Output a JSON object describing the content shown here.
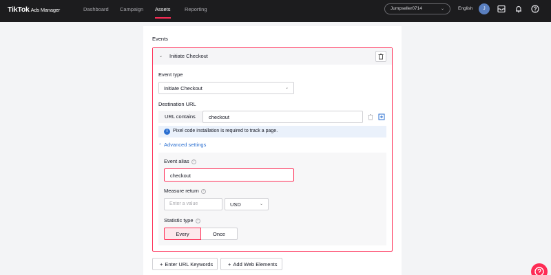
{
  "header": {
    "logo": "TikTok",
    "logo_sub": "Ads Manager",
    "nav": [
      "Dashboard",
      "Campaign",
      "Assets",
      "Reporting"
    ],
    "active_nav": "Assets",
    "account": "Jumpseller0714",
    "language": "English",
    "avatar_initial": "J"
  },
  "main": {
    "section_title": "Events",
    "event": {
      "header_title": "Initiate Checkout",
      "event_type_label": "Event type",
      "event_type_value": "Initiate Checkout",
      "destination_url_label": "Destination URL",
      "url_rule_label": "URL contains",
      "url_rule_value": "checkout",
      "info_text": "Pixel code installation is required to track a page.",
      "advanced_settings": "Advanced settings",
      "event_alias_label": "Event alias",
      "event_alias_value": "checkout",
      "measure_return_label": "Measure return",
      "measure_return_placeholder": "Enter a value",
      "currency": "USD",
      "statistic_type_label": "Statistic type",
      "statistic_options": [
        "Every",
        "Once"
      ],
      "statistic_selected": "Every"
    },
    "buttons": {
      "enter_url_keywords": "Enter URL Keywords",
      "add_web_elements": "Add Web Elements"
    }
  },
  "colors": {
    "accent": "#fe2c55",
    "link": "#2a6fd1",
    "topbar": "#1c1c1e"
  }
}
